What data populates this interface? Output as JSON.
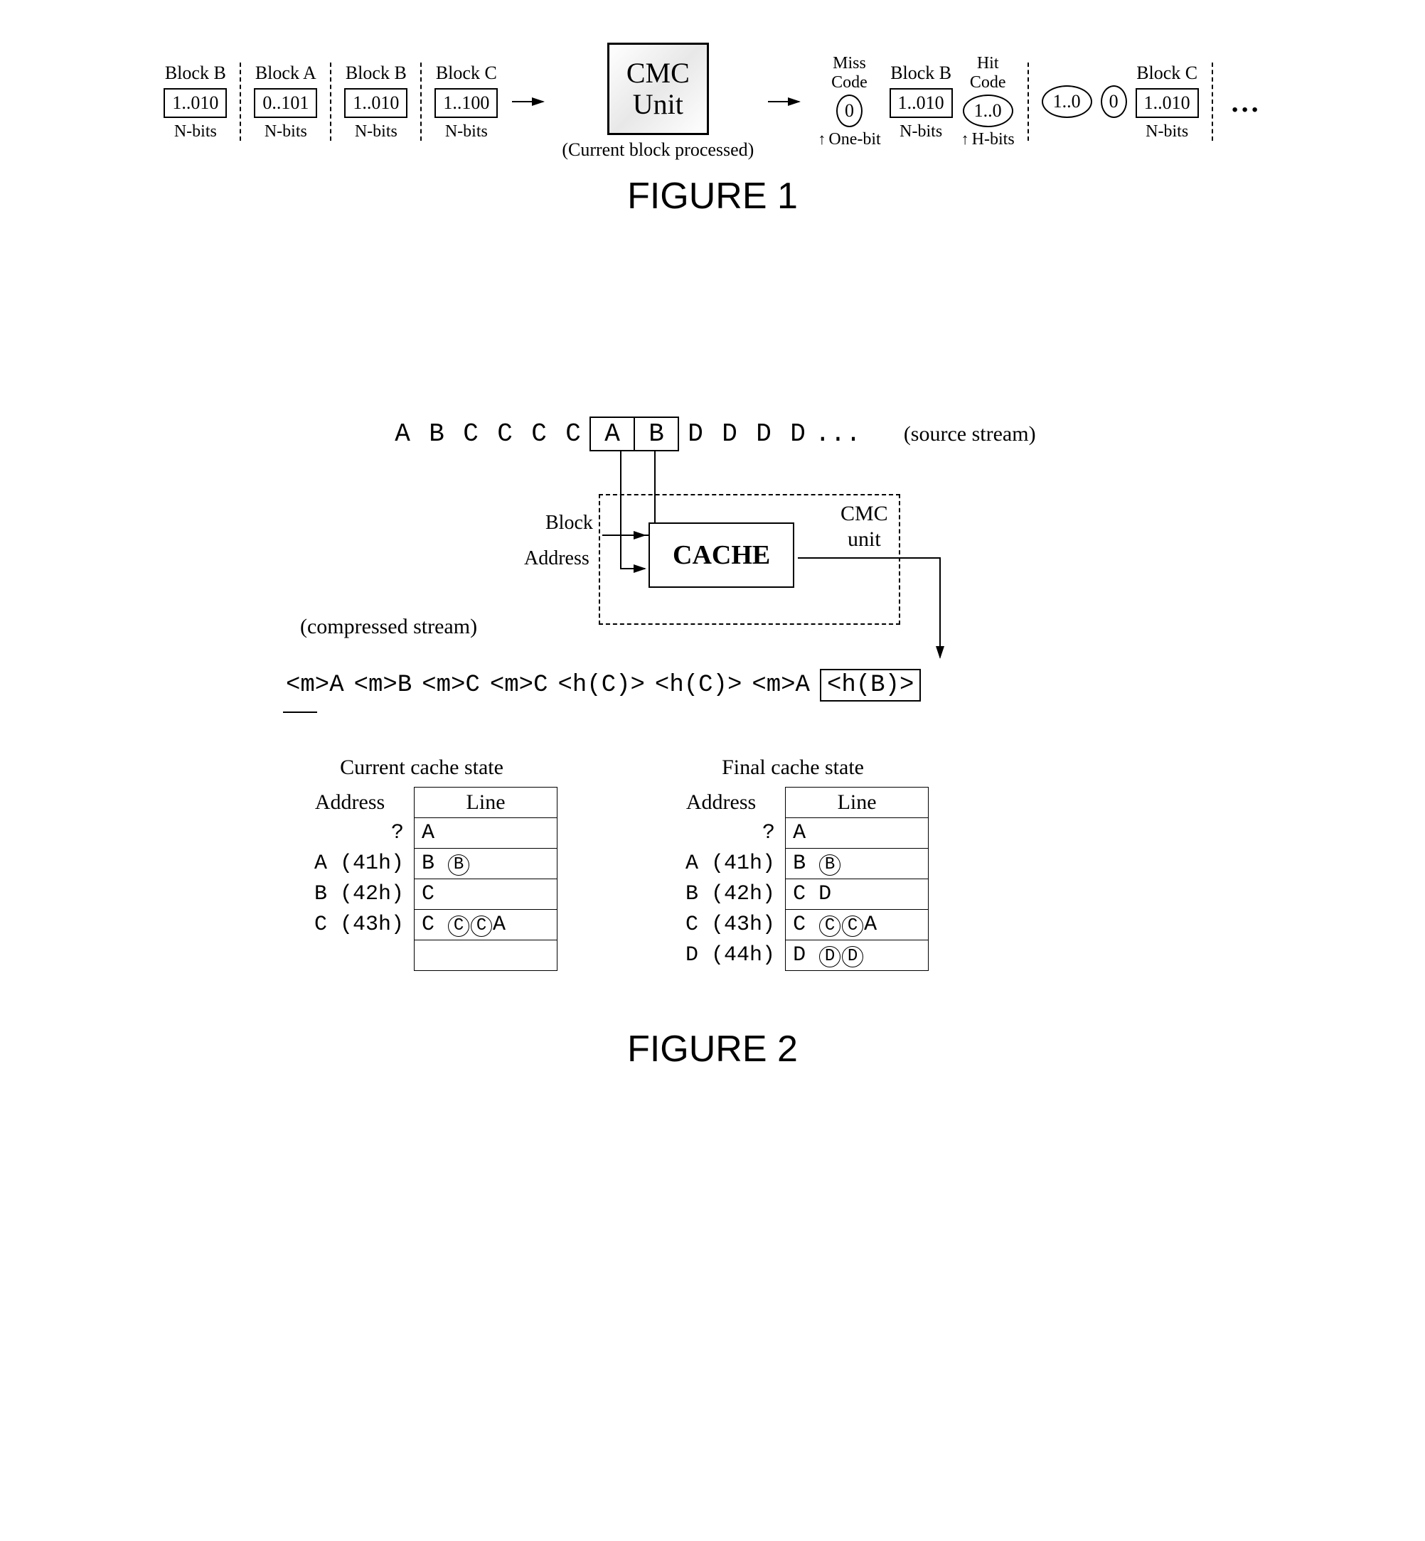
{
  "figure1": {
    "title": "FIGURE 1",
    "input_blocks": [
      {
        "label": "Block B",
        "bits": "1..010",
        "sub": "N-bits"
      },
      {
        "label": "Block A",
        "bits": "0..101",
        "sub": "N-bits"
      },
      {
        "label": "Block B",
        "bits": "1..010",
        "sub": "N-bits"
      },
      {
        "label": "Block C",
        "bits": "1..100",
        "sub": "N-bits"
      }
    ],
    "cmc": {
      "label_line1": "CMC",
      "label_line2": "Unit",
      "sub": "(Current block processed)"
    },
    "miss_code": {
      "title_l1": "Miss",
      "title_l2": "Code",
      "val": "0",
      "sub": "One-bit"
    },
    "out_block1": {
      "label": "Block B",
      "bits": "1..010",
      "sub": "N-bits"
    },
    "hit_code": {
      "title_l1": "Hit",
      "title_l2": "Code",
      "val": "1..0",
      "sub": "H-bits"
    },
    "extra_ovals": [
      "1..0",
      "0"
    ],
    "out_block2": {
      "label": "Block C",
      "bits": "1..010",
      "sub": "N-bits"
    },
    "ellipsis": "..."
  },
  "figure2": {
    "source_label": "(source stream)",
    "source_stream": [
      "A",
      "B",
      "C",
      "C",
      "C",
      "C",
      "A",
      "B",
      "D",
      "D",
      "D",
      "D",
      "..."
    ],
    "boxed_indices": [
      6,
      7
    ],
    "block_label": "Block",
    "address_label": "Address",
    "cache_label": "CACHE",
    "cmc_label_l1": "CMC",
    "cmc_label_l2": "unit",
    "compressed_label": "(compressed stream)",
    "compressed_tokens": [
      "<m>A",
      "<m>B",
      "<m>C",
      "<m>C",
      "<h(C)>",
      "<h(C)>",
      "<m>A",
      "<h(B)>"
    ],
    "compressed_boxed_index": 7,
    "tables": {
      "current": {
        "title": "Current cache state",
        "address_header": "Address",
        "line_header": "Line",
        "rows": [
          {
            "addr": "?",
            "line": [
              "A"
            ]
          },
          {
            "addr": "A (41h)",
            "line": [
              "B",
              {
                "circ": "B"
              }
            ]
          },
          {
            "addr": "B (42h)",
            "line": [
              "C"
            ]
          },
          {
            "addr": "C (43h)",
            "line": [
              "C",
              {
                "circ": "C"
              },
              {
                "circ": "C"
              },
              "A"
            ]
          },
          {
            "addr": "",
            "line": []
          }
        ]
      },
      "final": {
        "title": "Final cache state",
        "address_header": "Address",
        "line_header": "Line",
        "rows": [
          {
            "addr": "?",
            "line": [
              "A"
            ]
          },
          {
            "addr": "A (41h)",
            "line": [
              "B",
              {
                "circ": "B"
              }
            ]
          },
          {
            "addr": "B (42h)",
            "line": [
              "C",
              "D"
            ]
          },
          {
            "addr": "C (43h)",
            "line": [
              "C",
              {
                "circ": "C"
              },
              {
                "circ": "C"
              },
              "A"
            ]
          },
          {
            "addr": "D (44h)",
            "line": [
              "D",
              {
                "circ": "D"
              },
              {
                "circ": "D"
              }
            ]
          }
        ]
      }
    },
    "title": "FIGURE 2"
  }
}
